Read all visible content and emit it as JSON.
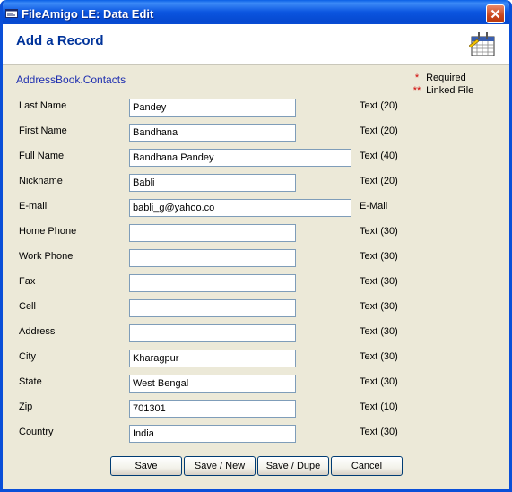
{
  "window": {
    "title": "FileAmigo LE: Data Edit"
  },
  "header": {
    "page_title": "Add a Record"
  },
  "table_name": "AddressBook.Contacts",
  "legend": [
    {
      "mark": "*",
      "label": "Required"
    },
    {
      "mark": "**",
      "label": "Linked File"
    }
  ],
  "fields": [
    {
      "label": "Last Name",
      "value": "Pandey",
      "type": "Text (20)"
    },
    {
      "label": "First Name",
      "value": "Bandhana",
      "type": "Text (20)"
    },
    {
      "label": "Full Name",
      "value": "Bandhana Pandey",
      "type": "Text (40)"
    },
    {
      "label": "Nickname",
      "value": "Babli",
      "type": "Text (20)"
    },
    {
      "label": "E-mail",
      "value": "babli_g@yahoo.co",
      "type": "E-Mail"
    },
    {
      "label": "Home Phone",
      "value": "",
      "type": "Text (30)"
    },
    {
      "label": "Work Phone",
      "value": "",
      "type": "Text (30)"
    },
    {
      "label": "Fax",
      "value": "",
      "type": "Text (30)"
    },
    {
      "label": "Cell",
      "value": "",
      "type": "Text (30)"
    },
    {
      "label": "Address",
      "value": "",
      "type": "Text (30)"
    },
    {
      "label": "City",
      "value": "Kharagpur",
      "type": "Text (30)"
    },
    {
      "label": "State",
      "value": "West Bengal",
      "type": "Text (30)"
    },
    {
      "label": "Zip",
      "value": "701301",
      "type": "Text (10)"
    },
    {
      "label": "Country",
      "value": "India",
      "type": "Text (30)"
    }
  ],
  "buttons": {
    "save": {
      "pre": "",
      "key": "S",
      "post": "ave"
    },
    "save_new": {
      "pre": "Save / ",
      "key": "N",
      "post": "ew"
    },
    "save_dupe": {
      "pre": "Save / ",
      "key": "D",
      "post": "upe"
    },
    "cancel": {
      "pre": "Cancel",
      "key": "",
      "post": ""
    }
  }
}
